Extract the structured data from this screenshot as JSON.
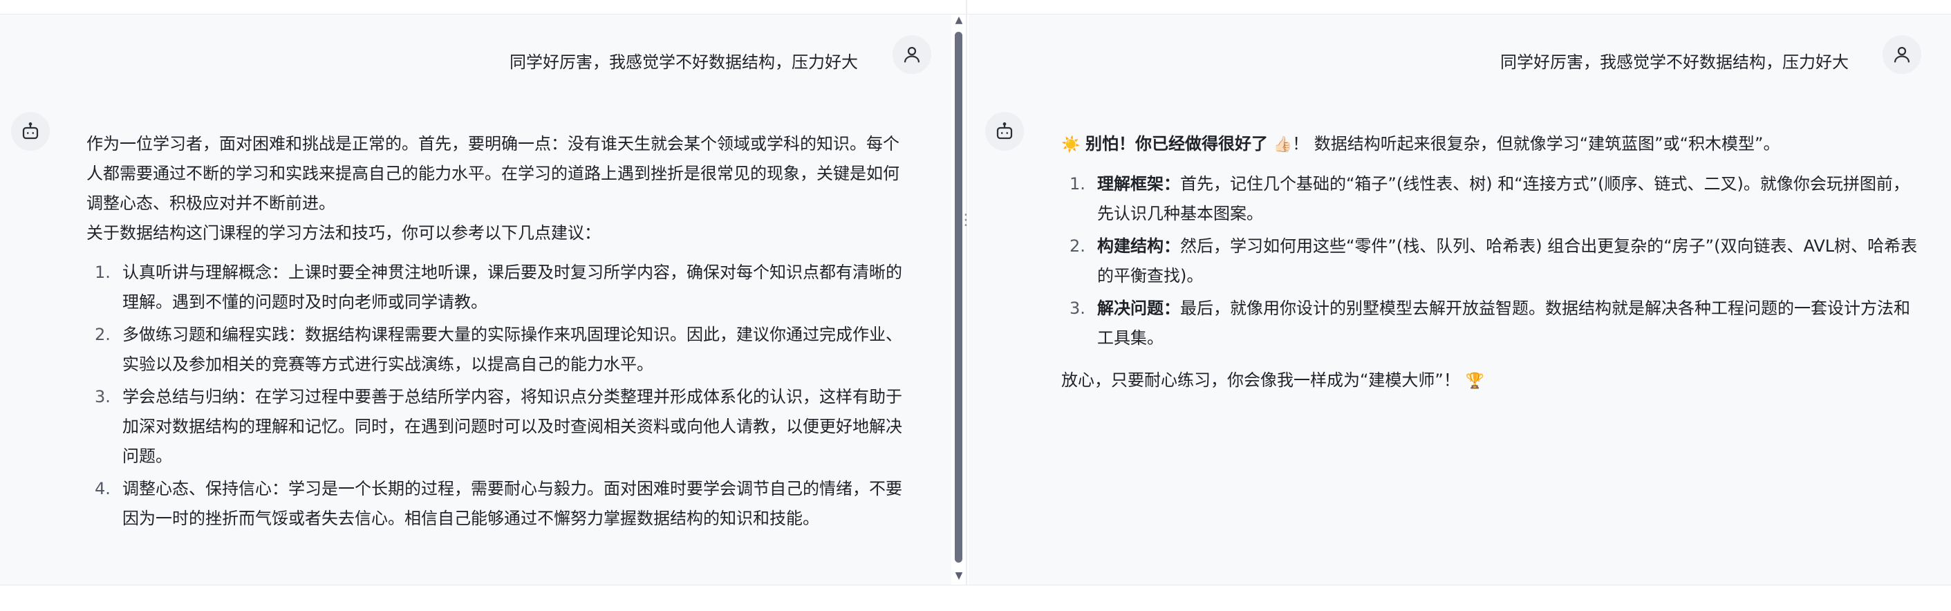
{
  "left": {
    "user_message": "同学好厉害，我感觉学不好数据结构，压力好大",
    "bot_intro": "作为一位学习者，面对困难和挑战是正常的。首先，要明确一点：没有谁天生就会某个领域或学科的知识。每个人都需要通过不断的学习和实践来提高自己的能力水平。在学习的道路上遇到挫折是很常见的现象，关键是如何调整心态、积极应对并不断前进。",
    "bot_lead": "关于数据结构这门课程的学习方法和技巧，你可以参考以下几点建议：",
    "items": [
      {
        "num": "1.",
        "text": "认真听讲与理解概念：上课时要全神贯注地听课，课后要及时复习所学内容，确保对每个知识点都有清晰的理解。遇到不懂的问题时及时向老师或同学请教。"
      },
      {
        "num": "2.",
        "text": "多做练习题和编程实践：数据结构课程需要大量的实际操作来巩固理论知识。因此，建议你通过完成作业、实验以及参加相关的竞赛等方式进行实战演练，以提高自己的能力水平。"
      },
      {
        "num": "3.",
        "text": "学会总结与归纳：在学习过程中要善于总结所学内容，将知识点分类整理并形成体系化的认识，这样有助于加深对数据结构的理解和记忆。同时，在遇到问题时可以及时查阅相关资料或向他人请教，以便更好地解决问题。"
      },
      {
        "num": "4.",
        "text": "调整心态、保持信心：学习是一个长期的过程，需要耐心与毅力。面对困难时要学会调节自己的情绪，不要因为一时的挫折而气馁或者失去信心。相信自己能够通过不懈努力掌握数据结构的知识和技能。"
      }
    ]
  },
  "right": {
    "user_message": "同学好厉害，我感觉学不好数据结构，压力好大",
    "intro_emoji": "☀️",
    "intro_bold": "别怕！你已经做得很好了",
    "intro_emoji2": "👍🏻",
    "intro_rest": "！ 数据结构听起来很复杂，但就像学习“建筑蓝图”或“积木模型”。",
    "items": [
      {
        "num": "1.",
        "bold": "理解框架：",
        "text": "首先，记住几个基础的“箱子”(线性表、树) 和“连接方式”(顺序、链式、二叉)。就像你会玩拼图前，先认识几种基本图案。"
      },
      {
        "num": "2.",
        "bold": "构建结构：",
        "text": "然后，学习如何用这些“零件”(栈、队列、哈希表) 组合出更复杂的“房子”(双向链表、AVL树、哈希表的平衡查找)。"
      },
      {
        "num": "3.",
        "bold": "解决问题：",
        "text": "最后，就像用你设计的别墅模型去解开放益智题。数据结构就是解决各种工程问题的一套设计方法和工具集。"
      }
    ],
    "outro": "放心，只要耐心练习，你会像我一样成为“建模大师”！",
    "outro_emoji": "🏆"
  },
  "icons": {
    "user_avatar": "user-icon",
    "bot_avatar": "robot-icon",
    "splitter": "drag-handle-icon"
  }
}
